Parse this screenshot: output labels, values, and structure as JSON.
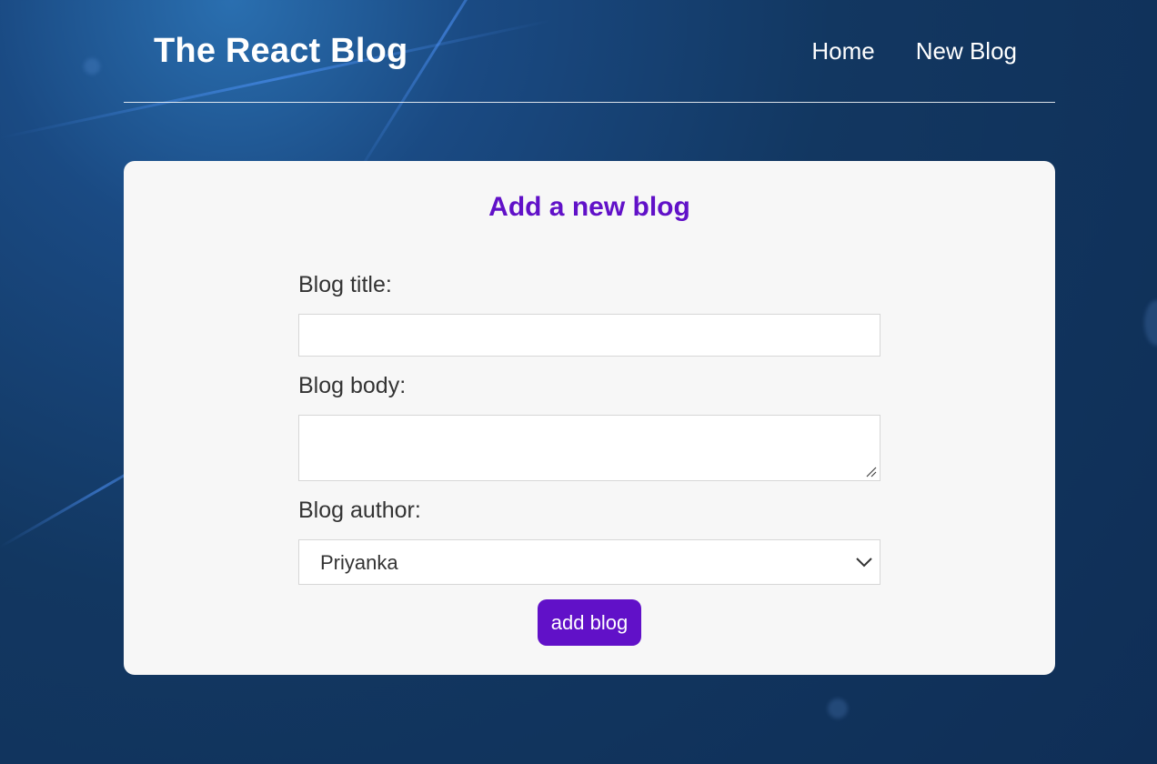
{
  "navbar": {
    "brand": "The React Blog",
    "links": [
      {
        "label": "Home"
      },
      {
        "label": "New Blog"
      }
    ]
  },
  "form": {
    "title": "Add a new blog",
    "title_field": {
      "label": "Blog title:",
      "value": ""
    },
    "body_field": {
      "label": "Blog body:",
      "value": ""
    },
    "author_field": {
      "label": "Blog author:",
      "selected": "Priyanka"
    },
    "submit_label": "add blog"
  },
  "colors": {
    "accent": "#6111c8",
    "card_background": "#f7f7f7",
    "page_background": "#123761",
    "nav_text": "#ffffff"
  },
  "icons": {
    "select_arrow": "chevron-down-icon",
    "textarea_resize": "resize-grip-icon"
  }
}
